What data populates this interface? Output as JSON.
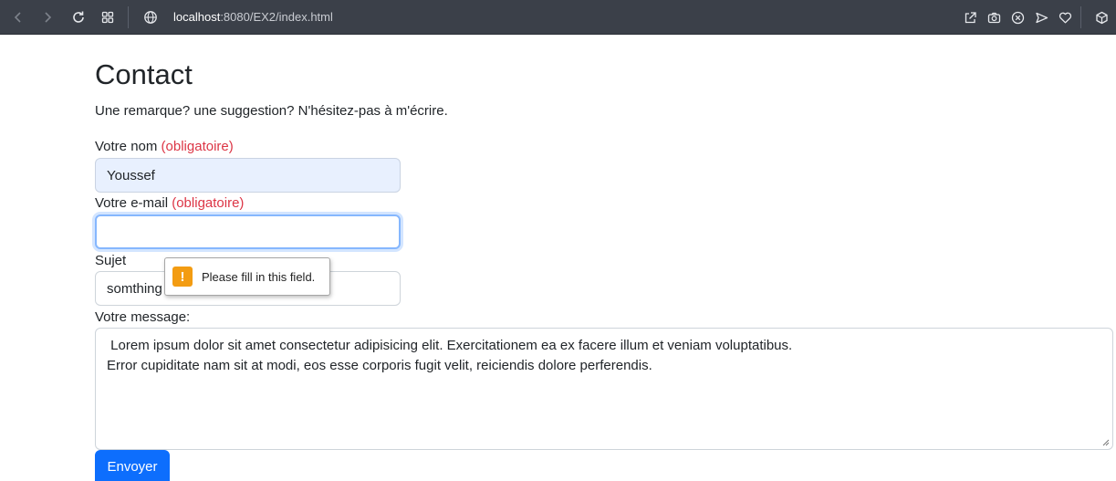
{
  "browser": {
    "url_host": "localhost",
    "url_rest": ":8080/EX2/index.html",
    "icons": [
      "back-icon",
      "forward-icon",
      "reload-icon",
      "tab-grid-icon",
      "globe-icon",
      "share-icon",
      "camera-icon",
      "shield-icon",
      "send-icon",
      "heart-icon",
      "box-icon"
    ]
  },
  "page": {
    "title": "Contact",
    "intro": "Une remarque? une suggestion? N'hésitez-pas à m'écrire."
  },
  "form": {
    "name_label": "Votre nom",
    "name_required": "(obligatoire)",
    "name_value": "Youssef",
    "email_label": "Votre e-mail",
    "email_required": "(obligatoire)",
    "email_value": "",
    "subject_label": "Sujet",
    "subject_value": "somthing",
    "message_label": "Votre message:",
    "message_lines": [
      " Lorem ipsum dolor sit amet consectetur adipisicing elit. Exercitationem ea ex facere illum et veniam voluptatibus.",
      "Error cupiditate nam sit at modi, eos esse corporis fugit velit, reiciendis dolore perferendis."
    ],
    "submit_label": "Envoyer"
  },
  "validation": {
    "message": "Please fill in this field."
  },
  "colors": {
    "primary": "#0d6efd",
    "required": "#dc3545",
    "warning": "#f39c12",
    "toolbar": "#3b4049"
  }
}
